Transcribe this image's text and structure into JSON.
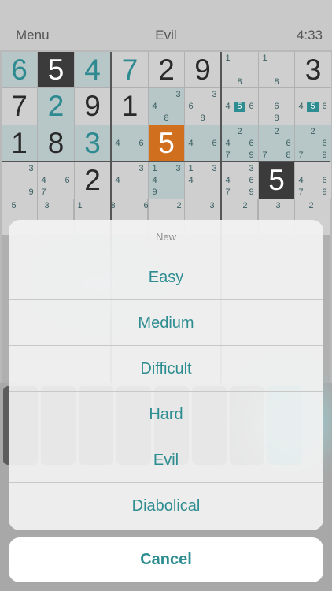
{
  "header": {
    "menu_label": "Menu",
    "title": "Evil",
    "time": "4:33"
  },
  "board": {
    "given_color": "#2a2a2a",
    "entered_color": "#2d8a90",
    "selected_color": "#d0701f",
    "rows": [
      [
        {
          "v": "6",
          "style": "blue",
          "hl": true
        },
        {
          "v": "5",
          "style": "white",
          "bg": "dark"
        },
        {
          "v": "4",
          "style": "blue",
          "hl": true
        },
        {
          "v": "7",
          "style": "blue"
        },
        {
          "v": "2"
        },
        {
          "v": "9"
        },
        {
          "pm": {
            "1": "1",
            "8": "8"
          }
        },
        {
          "pm": {
            "1": "1",
            "8": "8"
          }
        },
        {
          "v": "3"
        }
      ],
      [
        {
          "v": "7"
        },
        {
          "v": "2",
          "style": "blue",
          "hl": true
        },
        {
          "v": "9"
        },
        {
          "v": "1"
        },
        {
          "pm": {
            "3": "3",
            "4": "4",
            "8": "8"
          },
          "hl": true
        },
        {
          "pm": {
            "3": "3",
            "4": "6",
            "8": "8"
          }
        },
        {
          "pm": {
            "4": "4",
            "5": "5",
            "6": "6"
          },
          "sel": "5"
        },
        {
          "pm": {
            "5": "6",
            "8": "8"
          }
        },
        {
          "pm": {
            "4": "4",
            "5": "5",
            "6": "6"
          },
          "sel": "5"
        }
      ],
      [
        {
          "v": "1",
          "hl": true
        },
        {
          "v": "8",
          "hl": true
        },
        {
          "v": "3",
          "style": "blue",
          "hl": true
        },
        {
          "pm": {
            "4": "4",
            "6": "6"
          },
          "hl": true
        },
        {
          "v": "5",
          "style": "white",
          "bg": "orange"
        },
        {
          "pm": {
            "4": "4",
            "6": "6"
          },
          "hl": true
        },
        {
          "pm": {
            "2": "2",
            "4": "4",
            "6": "6",
            "7": "7",
            "9": "9"
          },
          "hl": true
        },
        {
          "pm": {
            "2": "2",
            "6": "6",
            "7": "7",
            "9": "8"
          },
          "hl": true
        },
        {
          "pm": {
            "2": "2",
            "6": "6",
            "7": "7",
            "9": "9"
          },
          "hl": true
        }
      ],
      [
        {
          "pm": {
            "3": "3",
            "9": "9"
          }
        },
        {
          "pm": {
            "4": "4",
            "6": "6",
            "7": "7"
          }
        },
        {
          "v": "2"
        },
        {
          "pm": {
            "3": "3",
            "4": "4"
          }
        },
        {
          "pm": {
            "1": "1",
            "3": "3",
            "4": "4",
            "7": "9"
          },
          "hl": true
        },
        {
          "pm": {
            "1": "1",
            "3": "3",
            "4": "4"
          }
        },
        {
          "pm": {
            "3": "3",
            "4": "4",
            "6": "6",
            "7": "7",
            "9": "9"
          }
        },
        {
          "v": "5",
          "style": "white",
          "bg": "dark"
        },
        {
          "pm": {
            "4": "4",
            "6": "6",
            "7": "7",
            "9": "9"
          }
        }
      ]
    ],
    "partial_row_hints": [
      "5",
      "3",
      "1",
      "8",
      "6",
      "2",
      "3",
      "2",
      "3",
      "2"
    ]
  },
  "sheet": {
    "title": "New",
    "options": [
      "Easy",
      "Medium",
      "Difficult",
      "Hard",
      "Evil",
      "Diabolical"
    ],
    "cancel_label": "Cancel"
  }
}
